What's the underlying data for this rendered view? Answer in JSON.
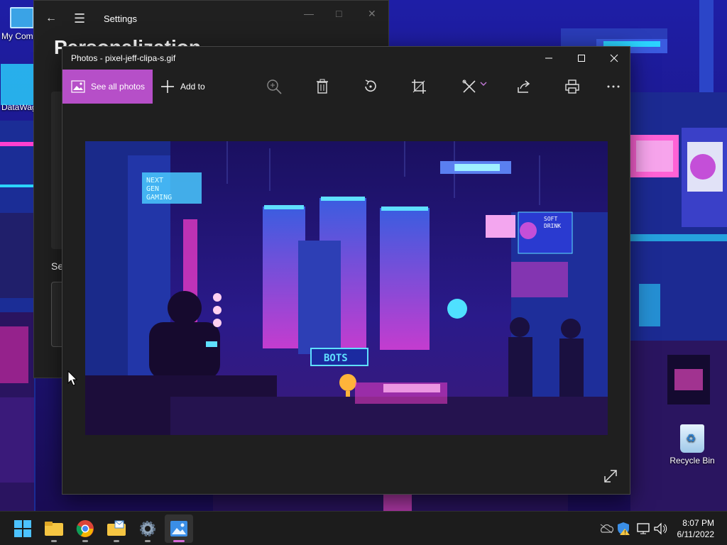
{
  "desktop": {
    "icons": [
      {
        "label": "My Com"
      },
      {
        "label": "DataWag"
      },
      {
        "label": "Recycle Bin"
      }
    ]
  },
  "settings_window": {
    "title": "Settings",
    "heading": "Personalization",
    "section_label": "Se"
  },
  "photos_window": {
    "title": "Photos - pixel-jeff-clipa-s.gif",
    "toolbar": {
      "see_all_photos": "See all photos",
      "add_to": "Add to",
      "icons": [
        "zoom-in-icon",
        "delete-icon",
        "rotate-icon",
        "crop-icon",
        "edit-icon",
        "share-icon",
        "print-icon",
        "more-icon"
      ]
    },
    "image_signs": {
      "next_gen": "NEXT GEN GAMING",
      "bots": "BOTS",
      "soft_drink": "SOFT DRINK"
    }
  },
  "taskbar": {
    "apps": [
      "start",
      "file-explorer",
      "chrome",
      "mail-folder",
      "settings",
      "photos"
    ],
    "active_app": "photos",
    "time": "8:07 PM",
    "date": "6/11/2022"
  },
  "colors": {
    "accent": "#b64fc8",
    "taskbar_bg": "#1c1c1c",
    "window_bg": "#1f1f1f"
  }
}
